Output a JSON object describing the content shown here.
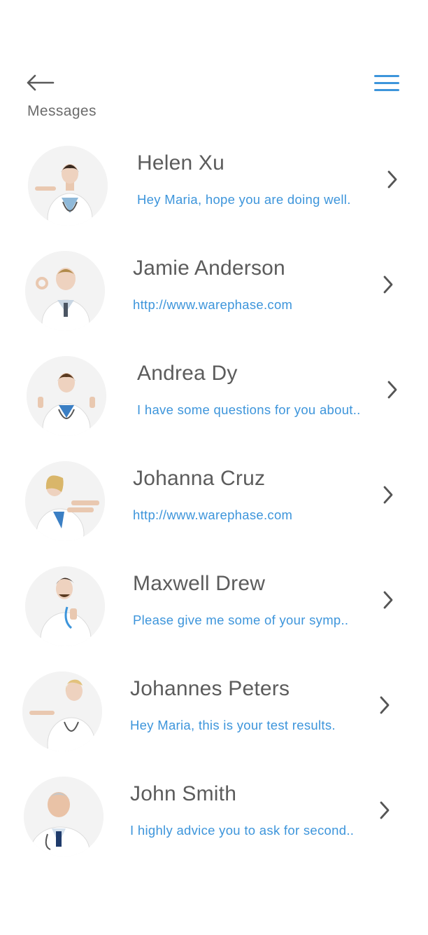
{
  "header": {
    "back_icon": "arrow-left-icon",
    "title": "Messages",
    "menu_icon": "hamburger-menu-icon"
  },
  "colors": {
    "accent": "#3d95db",
    "name_text": "#5c5c5c",
    "title_text": "#6b6b6b",
    "chevron": "#555555"
  },
  "messages": [
    {
      "name": "Helen Xu",
      "preview": "Hey Maria, hope you are doing well.",
      "avatar": "doctor-photo"
    },
    {
      "name": "Jamie Anderson",
      "preview": "http://www.warephase.com",
      "avatar": "doctor-photo"
    },
    {
      "name": "Andrea Dy",
      "preview": "I have some questions for you about..",
      "avatar": "doctor-photo"
    },
    {
      "name": "Johanna Cruz",
      "preview": "http://www.warephase.com",
      "avatar": "doctor-photo"
    },
    {
      "name": "Maxwell Drew",
      "preview": "Please give me some of your symp..",
      "avatar": "doctor-photo"
    },
    {
      "name": "Johannes Peters",
      "preview": "Hey Maria, this is your test results.",
      "avatar": "doctor-photo"
    },
    {
      "name": "John Smith",
      "preview": "I highly advice you to ask for second..",
      "avatar": "doctor-photo"
    }
  ]
}
